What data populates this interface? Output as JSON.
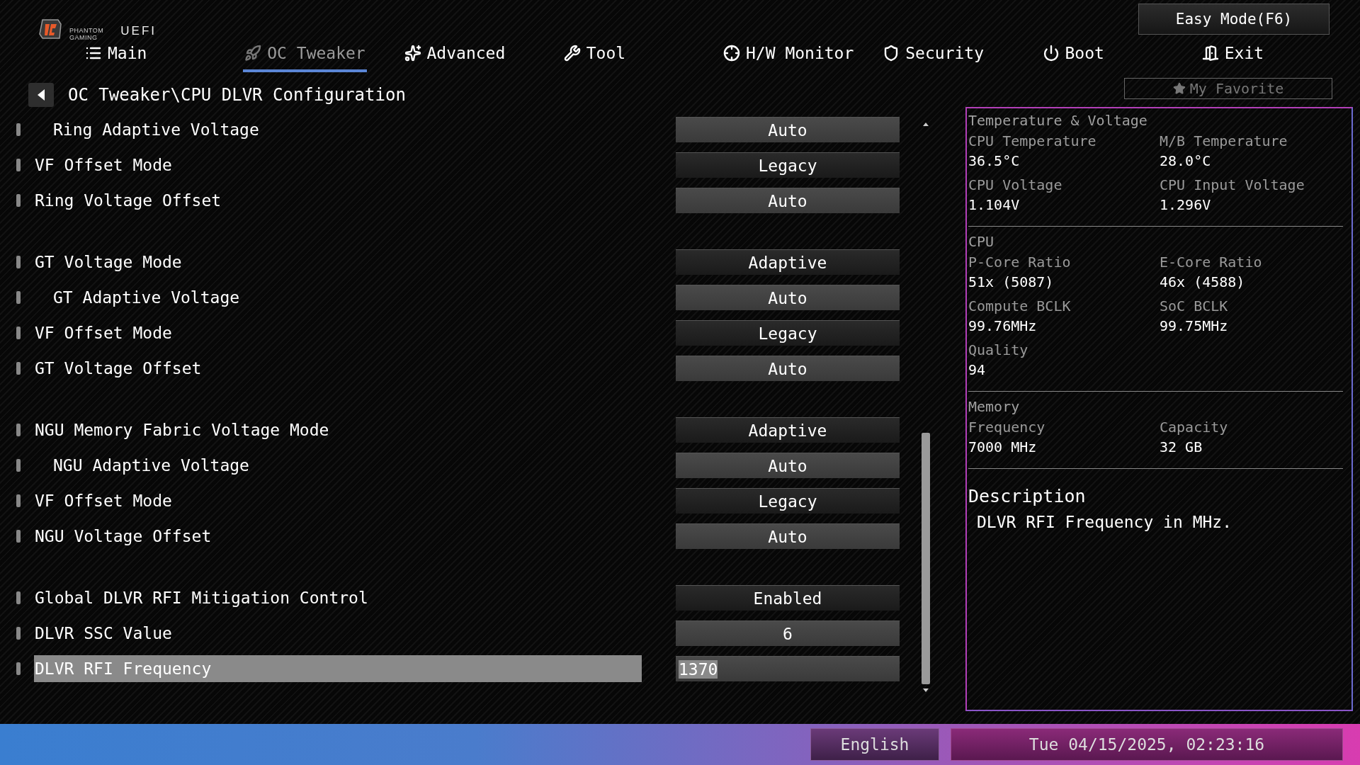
{
  "logo": {
    "brand_line_1": "PHANTOM",
    "brand_line_2": "GAMING",
    "product": "UEFI"
  },
  "easy_mode_button": "Easy Mode(F6)",
  "tabs": [
    {
      "label": "Main",
      "selected": false
    },
    {
      "label": "OC Tweaker",
      "selected": true
    },
    {
      "label": "Advanced",
      "selected": false
    },
    {
      "label": "Tool",
      "selected": false
    },
    {
      "label": "H/W Monitor",
      "selected": false
    },
    {
      "label": "Security",
      "selected": false
    },
    {
      "label": "Boot",
      "selected": false
    },
    {
      "label": "Exit",
      "selected": false
    }
  ],
  "breadcrumb": "OC Tweaker\\CPU DLVR Configuration",
  "my_favorite": "My Favorite",
  "settings": [
    [
      {
        "label": "Ring Adaptive Voltage",
        "value": "Auto",
        "kind": "input",
        "indented": true,
        "selected": false
      },
      {
        "label": "VF Offset Mode",
        "value": "Legacy",
        "kind": "select",
        "indented": false,
        "selected": false
      },
      {
        "label": "Ring Voltage Offset",
        "value": "Auto",
        "kind": "input",
        "indented": false,
        "selected": false
      }
    ],
    [
      {
        "label": "GT Voltage Mode",
        "value": "Adaptive",
        "kind": "select",
        "indented": false,
        "selected": false
      },
      {
        "label": "GT Adaptive Voltage",
        "value": "Auto",
        "kind": "input",
        "indented": true,
        "selected": false
      },
      {
        "label": "VF Offset Mode",
        "value": "Legacy",
        "kind": "select",
        "indented": false,
        "selected": false
      },
      {
        "label": "GT Voltage Offset",
        "value": "Auto",
        "kind": "input",
        "indented": false,
        "selected": false
      }
    ],
    [
      {
        "label": "NGU Memory Fabric Voltage Mode",
        "value": "Adaptive",
        "kind": "select",
        "indented": false,
        "selected": false
      },
      {
        "label": "NGU Adaptive Voltage",
        "value": "Auto",
        "kind": "input",
        "indented": true,
        "selected": false
      },
      {
        "label": "VF Offset Mode",
        "value": "Legacy",
        "kind": "select",
        "indented": false,
        "selected": false
      },
      {
        "label": "NGU Voltage Offset",
        "value": "Auto",
        "kind": "input",
        "indented": false,
        "selected": false
      }
    ],
    [
      {
        "label": "Global DLVR RFI Mitigation Control",
        "value": "Enabled",
        "kind": "select",
        "indented": false,
        "selected": false
      },
      {
        "label": "DLVR SSC Value",
        "value": "6",
        "kind": "input",
        "indented": false,
        "selected": false
      },
      {
        "label": "DLVR RFI Frequency",
        "value": "1370",
        "kind": "input",
        "indented": false,
        "selected": true
      }
    ]
  ],
  "hardware_monitor": [
    {
      "title": "Temperature & Voltage",
      "items": [
        {
          "label": "CPU Temperature",
          "value": "36.5°C"
        },
        {
          "label": "M/B Temperature",
          "value": "28.0°C"
        },
        {
          "label": "CPU Voltage",
          "value": "1.104V"
        },
        {
          "label": "CPU Input Voltage",
          "value": "1.296V"
        }
      ]
    },
    {
      "title": "CPU",
      "items": [
        {
          "label": "P-Core Ratio",
          "value": "51x (5087)"
        },
        {
          "label": "E-Core Ratio",
          "value": "46x (4588)"
        },
        {
          "label": "Compute BCLK",
          "value": "99.76MHz"
        },
        {
          "label": "SoC BCLK",
          "value": "99.75MHz"
        },
        {
          "label": "Quality",
          "value": "94"
        }
      ]
    },
    {
      "title": "Memory",
      "items": [
        {
          "label": "Frequency",
          "value": "7000 MHz"
        },
        {
          "label": "Capacity",
          "value": "32 GB"
        }
      ]
    }
  ],
  "description": {
    "title": "Description",
    "text": "DLVR RFI Frequency in MHz."
  },
  "status_bar": {
    "language": "English",
    "datetime": "Tue 04/15/2025, 02:23:16"
  }
}
